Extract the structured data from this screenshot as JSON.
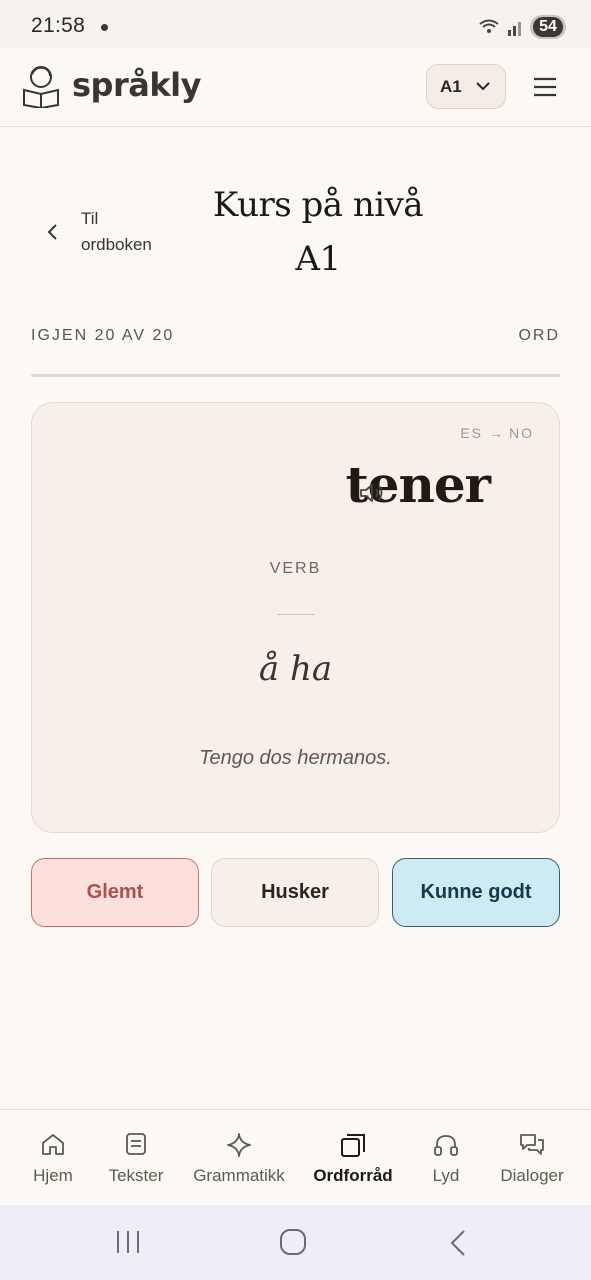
{
  "status_bar": {
    "time": "21:58",
    "battery": "54"
  },
  "header": {
    "logo_text": "språkly",
    "level_selector": "A1",
    "icons": {
      "logo": "reading-person-icon",
      "menu": "hamburger-menu-icon",
      "dropdown": "chevron-down-icon"
    }
  },
  "page": {
    "back_label_line1": "Til",
    "back_label_line2": "ordboken",
    "title_line1": "Kurs på nivå",
    "title_line2": "A1"
  },
  "progress": {
    "left_text": "IGJEN 20 AV 20",
    "right_text": "ORD",
    "fraction": 0.0
  },
  "card": {
    "lang_from": "ES",
    "lang_arrow": "→",
    "lang_to": "NO",
    "word": "tener",
    "part_of_speech": "VERB",
    "translation": "å ha",
    "example": "Tengo dos hermanos."
  },
  "answers": {
    "forgot": "Glemt",
    "remember": "Husker",
    "knew_well": "Kunne godt"
  },
  "bottom_nav": {
    "items": [
      {
        "label": "Hjem",
        "icon": "home-icon"
      },
      {
        "label": "Tekster",
        "icon": "document-icon"
      },
      {
        "label": "Grammatikk",
        "icon": "sparkle-icon"
      },
      {
        "label": "Ordforråd",
        "icon": "cards-icon",
        "active": true
      },
      {
        "label": "Lyd",
        "icon": "headphones-icon"
      },
      {
        "label": "Dialoger",
        "icon": "chat-bubbles-icon"
      }
    ]
  },
  "colors": {
    "background": "#fcf9f4",
    "forgot_bg": "#fde0dd",
    "forgot_text": "#b0504c",
    "knew_bg": "#cdebf4",
    "knew_text": "#16384b"
  }
}
